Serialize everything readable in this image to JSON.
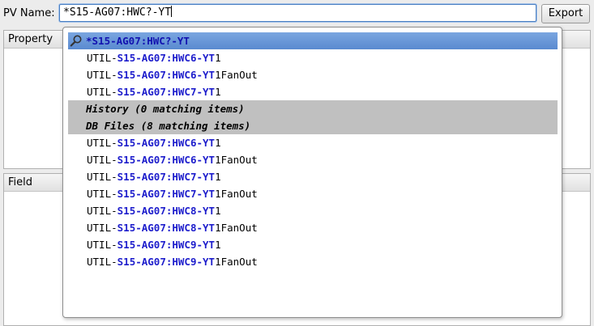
{
  "pv": {
    "label": "PV Name:",
    "value": "*S15-AG07:HWC?-YT"
  },
  "export_label": "Export",
  "panels": {
    "property_header": "Property",
    "field_header": "Field"
  },
  "dropdown": {
    "selected": {
      "icon": "search-icon",
      "text": "*S15-AG07:HWC?-YT"
    },
    "history_items": [
      {
        "prefix": "UTIL-",
        "match": "S15-AG07:HWC6-YT",
        "suffix": "1"
      },
      {
        "prefix": "UTIL-",
        "match": "S15-AG07:HWC6-YT",
        "suffix": "1FanOut"
      },
      {
        "prefix": "UTIL-",
        "match": "S15-AG07:HWC7-YT",
        "suffix": "1"
      }
    ],
    "section_history": "History (0 matching items)",
    "section_db": "DB Files (8 matching items)",
    "db_items": [
      {
        "prefix": "UTIL-",
        "match": "S15-AG07:HWC6-YT",
        "suffix": "1"
      },
      {
        "prefix": "UTIL-",
        "match": "S15-AG07:HWC6-YT",
        "suffix": "1FanOut"
      },
      {
        "prefix": "UTIL-",
        "match": "S15-AG07:HWC7-YT",
        "suffix": "1"
      },
      {
        "prefix": "UTIL-",
        "match": "S15-AG07:HWC7-YT",
        "suffix": "1FanOut"
      },
      {
        "prefix": "UTIL-",
        "match": "S15-AG07:HWC8-YT",
        "suffix": "1"
      },
      {
        "prefix": "UTIL-",
        "match": "S15-AG07:HWC8-YT",
        "suffix": "1FanOut"
      },
      {
        "prefix": "UTIL-",
        "match": "S15-AG07:HWC9-YT",
        "suffix": "1"
      },
      {
        "prefix": "UTIL-",
        "match": "S15-AG07:HWC9-YT",
        "suffix": "1FanOut"
      }
    ]
  }
}
